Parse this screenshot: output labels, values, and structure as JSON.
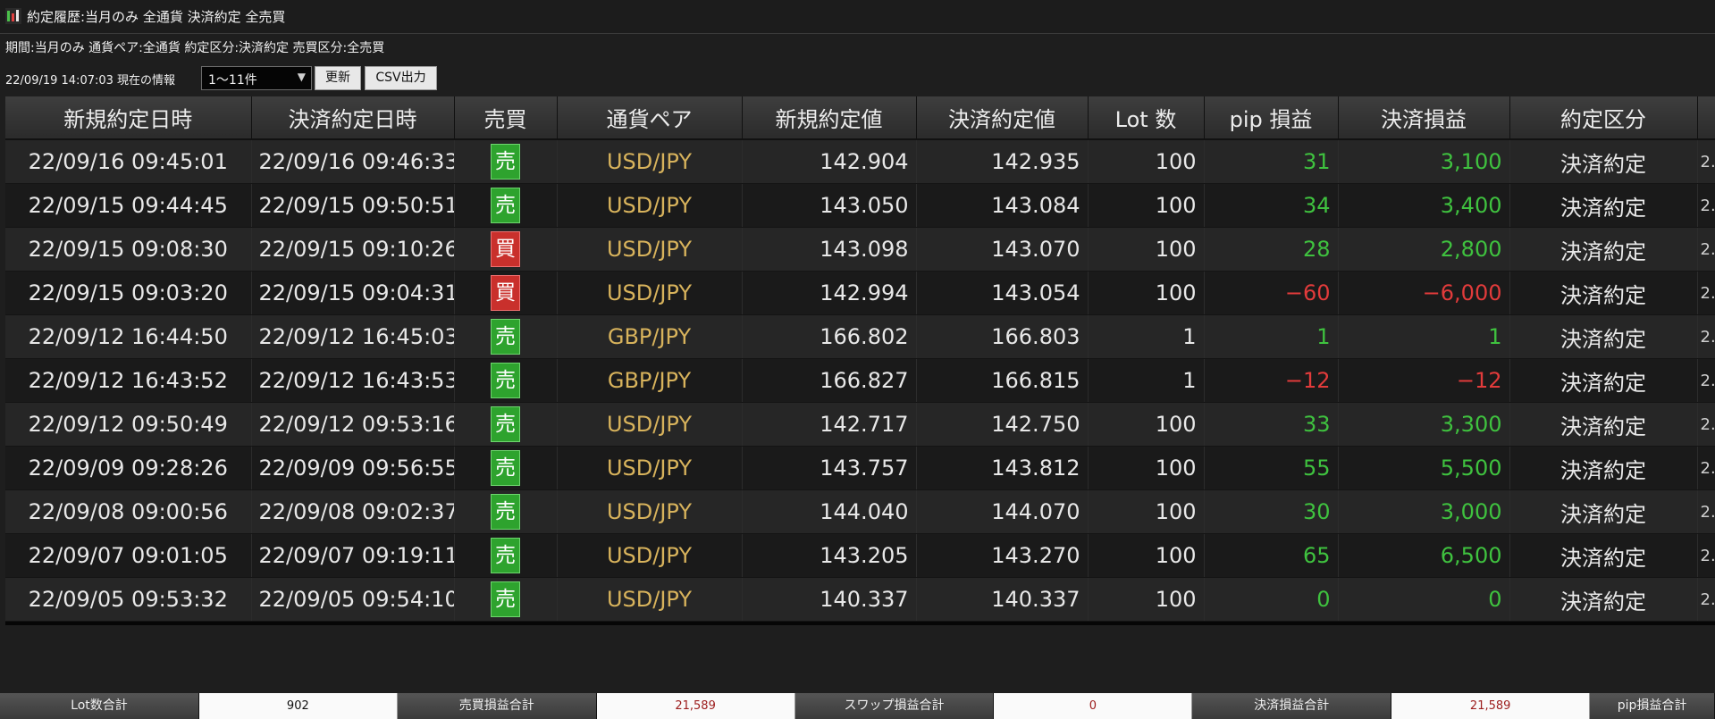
{
  "window": {
    "title": "約定履歴:当月のみ 全通貨 決済約定 全売買",
    "icon": "app-chart-icon"
  },
  "filter_summary": "期間:当月のみ 通貨ペア:全通貨 約定区分:決済約定 売買区分:全売買",
  "info_text": "22/09/19 14:07:03 現在の情報",
  "range_select": {
    "value": "1〜11件"
  },
  "buttons": {
    "refresh": "更新",
    "csv": "CSV出力"
  },
  "table": {
    "headers": [
      "新規約定日時",
      "決済約定日時",
      "売買",
      "通貨ペア",
      "新規約定値",
      "決済約定値",
      "Lot 数",
      "pip 損益",
      "決済損益",
      "約定区分"
    ],
    "overflow_marker": "2.",
    "rows": [
      {
        "open_time": "22/09/16 09:45:01",
        "close_time": "22/09/16 09:46:33",
        "side": "売",
        "side_type": "sell",
        "pair": "USD/JPY",
        "open_price": "142.904",
        "close_price": "142.935",
        "lots": "100",
        "pips": "31",
        "pips_sign": "pos",
        "pl": "3,100",
        "pl_sign": "pos",
        "kind": "決済約定"
      },
      {
        "open_time": "22/09/15 09:44:45",
        "close_time": "22/09/15 09:50:51",
        "side": "売",
        "side_type": "sell",
        "pair": "USD/JPY",
        "open_price": "143.050",
        "close_price": "143.084",
        "lots": "100",
        "pips": "34",
        "pips_sign": "pos",
        "pl": "3,400",
        "pl_sign": "pos",
        "kind": "決済約定"
      },
      {
        "open_time": "22/09/15 09:08:30",
        "close_time": "22/09/15 09:10:26",
        "side": "買",
        "side_type": "buy",
        "pair": "USD/JPY",
        "open_price": "143.098",
        "close_price": "143.070",
        "lots": "100",
        "pips": "28",
        "pips_sign": "pos",
        "pl": "2,800",
        "pl_sign": "pos",
        "kind": "決済約定"
      },
      {
        "open_time": "22/09/15 09:03:20",
        "close_time": "22/09/15 09:04:31",
        "side": "買",
        "side_type": "buy",
        "pair": "USD/JPY",
        "open_price": "142.994",
        "close_price": "143.054",
        "lots": "100",
        "pips": "−60",
        "pips_sign": "neg",
        "pl": "−6,000",
        "pl_sign": "neg",
        "kind": "決済約定"
      },
      {
        "open_time": "22/09/12 16:44:50",
        "close_time": "22/09/12 16:45:03",
        "side": "売",
        "side_type": "sell",
        "pair": "GBP/JPY",
        "open_price": "166.802",
        "close_price": "166.803",
        "lots": "1",
        "pips": "1",
        "pips_sign": "pos",
        "pl": "1",
        "pl_sign": "pos",
        "kind": "決済約定"
      },
      {
        "open_time": "22/09/12 16:43:52",
        "close_time": "22/09/12 16:43:53",
        "side": "売",
        "side_type": "sell",
        "pair": "GBP/JPY",
        "open_price": "166.827",
        "close_price": "166.815",
        "lots": "1",
        "pips": "−12",
        "pips_sign": "neg",
        "pl": "−12",
        "pl_sign": "neg",
        "kind": "決済約定"
      },
      {
        "open_time": "22/09/12 09:50:49",
        "close_time": "22/09/12 09:53:16",
        "side": "売",
        "side_type": "sell",
        "pair": "USD/JPY",
        "open_price": "142.717",
        "close_price": "142.750",
        "lots": "100",
        "pips": "33",
        "pips_sign": "pos",
        "pl": "3,300",
        "pl_sign": "pos",
        "kind": "決済約定"
      },
      {
        "open_time": "22/09/09 09:28:26",
        "close_time": "22/09/09 09:56:55",
        "side": "売",
        "side_type": "sell",
        "pair": "USD/JPY",
        "open_price": "143.757",
        "close_price": "143.812",
        "lots": "100",
        "pips": "55",
        "pips_sign": "pos",
        "pl": "5,500",
        "pl_sign": "pos",
        "kind": "決済約定"
      },
      {
        "open_time": "22/09/08 09:00:56",
        "close_time": "22/09/08 09:02:37",
        "side": "売",
        "side_type": "sell",
        "pair": "USD/JPY",
        "open_price": "144.040",
        "close_price": "144.070",
        "lots": "100",
        "pips": "30",
        "pips_sign": "pos",
        "pl": "3,000",
        "pl_sign": "pos",
        "kind": "決済約定"
      },
      {
        "open_time": "22/09/07 09:01:05",
        "close_time": "22/09/07 09:19:11",
        "side": "売",
        "side_type": "sell",
        "pair": "USD/JPY",
        "open_price": "143.205",
        "close_price": "143.270",
        "lots": "100",
        "pips": "65",
        "pips_sign": "pos",
        "pl": "6,500",
        "pl_sign": "pos",
        "kind": "決済約定"
      },
      {
        "open_time": "22/09/05 09:53:32",
        "close_time": "22/09/05 09:54:10",
        "side": "売",
        "side_type": "sell",
        "pair": "USD/JPY",
        "open_price": "140.337",
        "close_price": "140.337",
        "lots": "100",
        "pips": "0",
        "pips_sign": "pos",
        "pl": "0",
        "pl_sign": "pos",
        "kind": "決済約定"
      }
    ]
  },
  "footer": [
    {
      "label": "Lot数合計",
      "value": "902",
      "value_color": "#111111"
    },
    {
      "label": "売買損益合計",
      "value": "21,589",
      "value_color": "#9c1c1c"
    },
    {
      "label": "スワップ損益合計",
      "value": "0",
      "value_color": "#9c1c1c"
    },
    {
      "label": "決済損益合計",
      "value": "21,589",
      "value_color": "#9c1c1c"
    },
    {
      "label": "pip損益合計",
      "value": "",
      "value_color": "#9c1c1c"
    }
  ],
  "colors": {
    "sell_badge": "#2ea32e",
    "buy_badge": "#c9302c",
    "profit": "#3fc23f",
    "loss": "#e23b3b",
    "pair": "#d8b35c"
  }
}
